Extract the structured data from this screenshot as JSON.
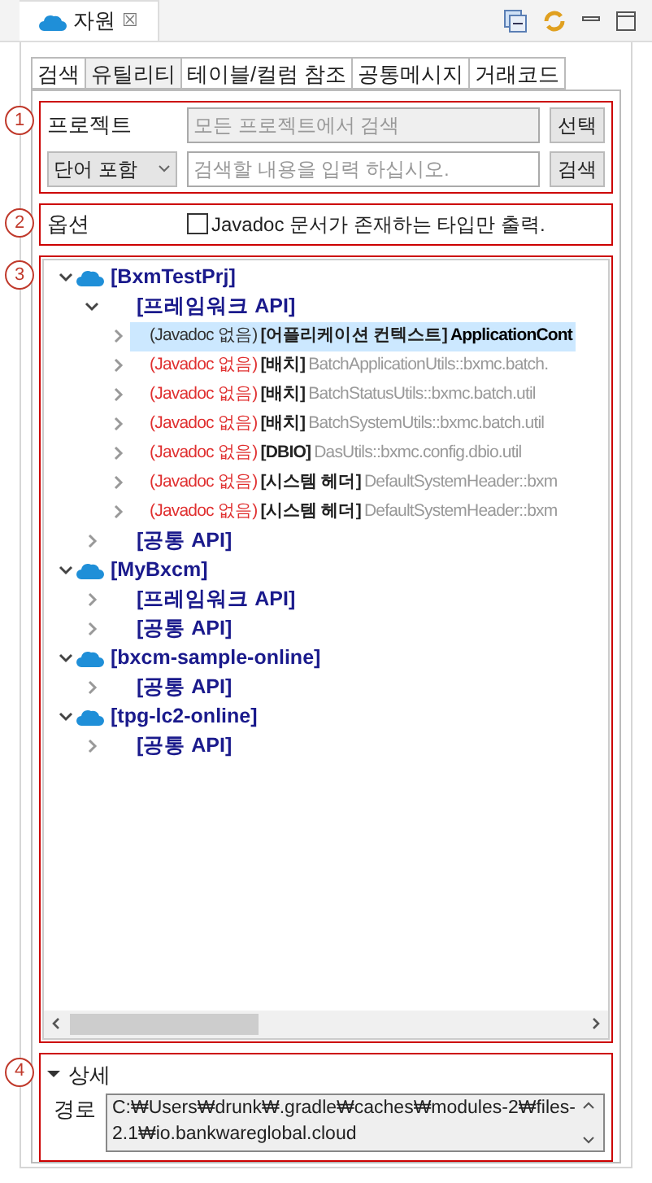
{
  "view_tab": {
    "title": "자원",
    "close": "☒"
  },
  "tabs": [
    {
      "label": "검색",
      "selected": false
    },
    {
      "label": "유틸리티",
      "selected": true
    },
    {
      "label": "테이블/컬럼 참조",
      "selected": false
    },
    {
      "label": "공통메시지",
      "selected": false
    },
    {
      "label": "거래코드",
      "selected": false
    }
  ],
  "search_section": {
    "marker": "1",
    "project_label": "프로젝트",
    "project_placeholder": "모든 프로젝트에서 검색",
    "select_button": "선택",
    "match_mode": "단어 포함",
    "query_placeholder": "검색할 내용을 입력 하십시오.",
    "search_button": "검색"
  },
  "options_section": {
    "marker": "2",
    "label": "옵션",
    "javadoc_only": {
      "label": "Javadoc 문서가 존재하는 타입만 출력.",
      "checked": false
    }
  },
  "tree_section": {
    "marker": "3",
    "items": [
      {
        "kind": "project",
        "label": "[BxmTestPrj]",
        "expanded": true,
        "children": [
          {
            "kind": "group",
            "label": "[프레임워크 API]",
            "expanded": true,
            "children": [
              {
                "kind": "class",
                "note": "(Javadoc 없음)",
                "category": "[어플리케이션 컨텍스트]",
                "name": "ApplicationCont",
                "selected": true,
                "expanded": false
              },
              {
                "kind": "class",
                "note": "(Javadoc 없음)",
                "category": "[배치]",
                "name": "BatchApplicationUtils::bxmc.batch.",
                "selected": false,
                "expanded": false
              },
              {
                "kind": "class",
                "note": "(Javadoc 없음)",
                "category": "[배치]",
                "name": "BatchStatusUtils::bxmc.batch.util",
                "selected": false,
                "expanded": false
              },
              {
                "kind": "class",
                "note": "(Javadoc 없음)",
                "category": "[배치]",
                "name": "BatchSystemUtils::bxmc.batch.util",
                "selected": false,
                "expanded": false
              },
              {
                "kind": "class",
                "note": "(Javadoc 없음)",
                "category": "[DBIO]",
                "name": "DasUtils::bxmc.config.dbio.util",
                "selected": false,
                "expanded": false
              },
              {
                "kind": "class",
                "note": "(Javadoc 없음)",
                "category": "[시스템 헤더]",
                "name": "DefaultSystemHeader::bxm",
                "selected": false,
                "expanded": false
              },
              {
                "kind": "class",
                "note": "(Javadoc 없음)",
                "category": "[시스템 헤더]",
                "name": "DefaultSystemHeader::bxm",
                "selected": false,
                "expanded": false
              }
            ]
          },
          {
            "kind": "group",
            "label": "[공통 API]",
            "expanded": false
          }
        ]
      },
      {
        "kind": "project",
        "label": "[MyBxcm]",
        "expanded": true,
        "children": [
          {
            "kind": "group",
            "label": "[프레임워크 API]",
            "expanded": false
          },
          {
            "kind": "group",
            "label": "[공통 API]",
            "expanded": false
          }
        ]
      },
      {
        "kind": "project",
        "label": "[bxcm-sample-online]",
        "expanded": true,
        "children": [
          {
            "kind": "group",
            "label": "[공통 API]",
            "expanded": false
          }
        ]
      },
      {
        "kind": "project",
        "label": "[tpg-lc2-online]",
        "expanded": true,
        "children": [
          {
            "kind": "group",
            "label": "[공통 API]",
            "expanded": false
          }
        ]
      }
    ]
  },
  "details_section": {
    "marker": "4",
    "title": "상세",
    "expanded": true,
    "path_label": "경로",
    "path_value": "C:₩Users₩drunk₩.gradle₩caches₩modules-2₩files-2.1₩io.bankwareglobal.cloud"
  }
}
